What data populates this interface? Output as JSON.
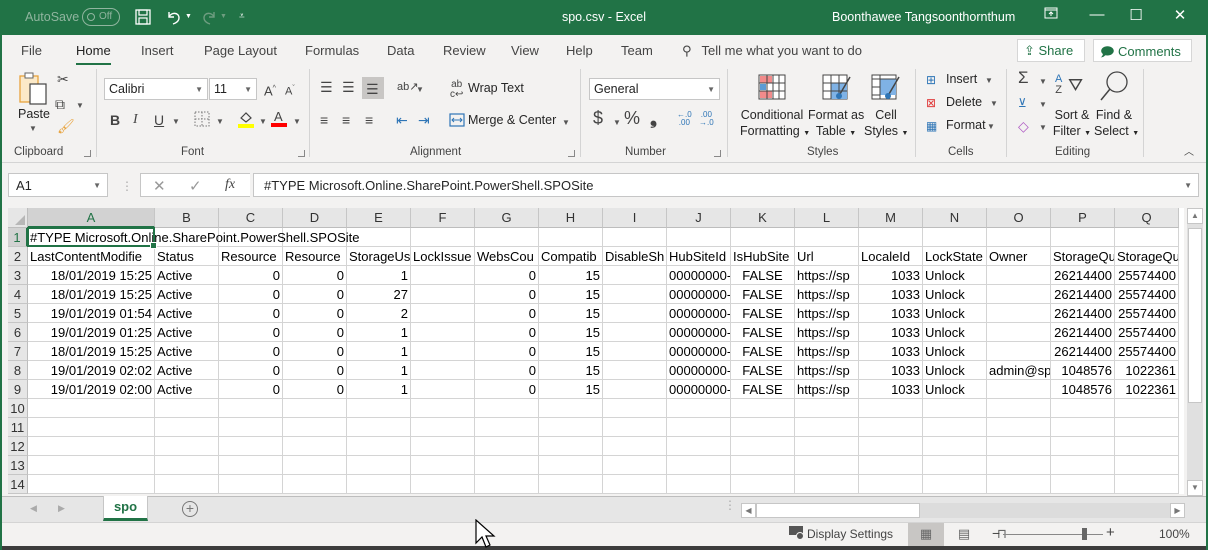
{
  "titlebar": {
    "autosave_label": "AutoSave",
    "autosave_state": "Off",
    "title": "spo.csv  -  Excel",
    "user": "Boonthawee Tangsoonthornthum",
    "icons": [
      "save-icon",
      "undo-icon",
      "redo-icon",
      "customize-qat-icon",
      "ribbon-display-icon",
      "minimize-icon",
      "maximize-icon",
      "close-icon"
    ]
  },
  "tabs": [
    {
      "label": "File"
    },
    {
      "label": "Home",
      "active": true
    },
    {
      "label": "Insert"
    },
    {
      "label": "Page Layout"
    },
    {
      "label": "Formulas"
    },
    {
      "label": "Data"
    },
    {
      "label": "Review"
    },
    {
      "label": "View"
    },
    {
      "label": "Help"
    },
    {
      "label": "Team"
    }
  ],
  "tell_me": "Tell me what you want to do",
  "share_label": "Share",
  "comments_label": "Comments",
  "ribbon": {
    "clipboard": {
      "label": "Clipboard",
      "paste": "Paste"
    },
    "font": {
      "label": "Font",
      "name": "Calibri",
      "size": "11",
      "bold": "B",
      "italic": "I",
      "underline": "U",
      "fill_color": "#ffff00",
      "font_color": "#ff0000"
    },
    "alignment": {
      "label": "Alignment",
      "wrap_text": "Wrap Text",
      "merge_center": "Merge & Center"
    },
    "number": {
      "label": "Number",
      "format": "General",
      "currency": "$",
      "percent": "%",
      "comma": "❟"
    },
    "styles": {
      "label": "Styles",
      "conditional_1": "Conditional",
      "conditional_2": "Formatting",
      "format_table_1": "Format as",
      "format_table_2": "Table",
      "cell_styles_1": "Cell",
      "cell_styles_2": "Styles"
    },
    "cells": {
      "label": "Cells",
      "insert": "Insert",
      "delete": "Delete",
      "format": "Format"
    },
    "editing": {
      "label": "Editing",
      "sort_1": "Sort &",
      "sort_2": "Filter",
      "find_1": "Find &",
      "find_2": "Select"
    }
  },
  "formula_bar": {
    "name_box": "A1",
    "cancel": "✕",
    "enter": "✓",
    "fx": "fx",
    "formula": "#TYPE Microsoft.Online.SharePoint.PowerShell.SPOSite"
  },
  "grid": {
    "columns": [
      "A",
      "B",
      "C",
      "D",
      "E",
      "F",
      "G",
      "H",
      "I",
      "J",
      "K",
      "L",
      "M",
      "N",
      "O",
      "P",
      "Q"
    ],
    "selected_column": "A",
    "selected_row": "1",
    "selected_cell": "A1",
    "row_numbers": [
      "1",
      "2",
      "3",
      "4",
      "5",
      "6",
      "7",
      "8",
      "9",
      "10",
      "11",
      "12",
      "13",
      "14"
    ],
    "rows": [
      [
        "#TYPE Microsoft.Online.SharePoint.PowerShell.SPOSite",
        "",
        "",
        "",
        "",
        "",
        "",
        "",
        "",
        "",
        "",
        "",
        "",
        "",
        "",
        "",
        ""
      ],
      [
        "LastContentModifie",
        "Status",
        "Resource\u0000",
        "Resource\u0000",
        "StorageUs",
        "LockIssue",
        "WebsCou",
        "Compatib",
        "DisableSh",
        "HubSiteId",
        "IsHubSite",
        "Url",
        "LocaleId",
        "LockState",
        "Owner",
        "StorageQu",
        "StorageQu"
      ],
      [
        "18/01/2019 15:25",
        "Active",
        "0",
        "0",
        "1",
        "",
        "0",
        "15",
        "",
        "00000000-",
        "FALSE",
        "https://sp",
        "1033",
        "Unlock",
        "",
        "26214400",
        "25574400"
      ],
      [
        "18/01/2019 15:25",
        "Active",
        "0",
        "0",
        "27",
        "",
        "0",
        "15",
        "",
        "00000000-",
        "FALSE",
        "https://sp",
        "1033",
        "Unlock",
        "",
        "26214400",
        "25574400"
      ],
      [
        "19/01/2019 01:54",
        "Active",
        "0",
        "0",
        "2",
        "",
        "0",
        "15",
        "",
        "00000000-",
        "FALSE",
        "https://sp",
        "1033",
        "Unlock",
        "",
        "26214400",
        "25574400"
      ],
      [
        "19/01/2019 01:25",
        "Active",
        "0",
        "0",
        "1",
        "",
        "0",
        "15",
        "",
        "00000000-",
        "FALSE",
        "https://sp",
        "1033",
        "Unlock",
        "",
        "26214400",
        "25574400"
      ],
      [
        "18/01/2019 15:25",
        "Active",
        "0",
        "0",
        "1",
        "",
        "0",
        "15",
        "",
        "00000000-",
        "FALSE",
        "https://sp",
        "1033",
        "Unlock",
        "",
        "26214400",
        "25574400"
      ],
      [
        "19/01/2019 02:02",
        "Active",
        "0",
        "0",
        "1",
        "",
        "0",
        "15",
        "",
        "00000000-",
        "FALSE",
        "https://sp",
        "1033",
        "Unlock",
        "admin@sp",
        "1048576",
        "1022361"
      ],
      [
        "19/01/2019 02:00",
        "Active",
        "0",
        "0",
        "1",
        "",
        "0",
        "15",
        "",
        "00000000-",
        "FALSE",
        "https://sp",
        "1033",
        "Unlock",
        "",
        "1048576",
        "1022361"
      ],
      [
        "",
        "",
        "",
        "",
        "",
        "",
        "",
        "",
        "",
        "",
        "",
        "",
        "",
        "",
        "",
        "",
        ""
      ],
      [
        "",
        "",
        "",
        "",
        "",
        "",
        "",
        "",
        "",
        "",
        "",
        "",
        "",
        "",
        "",
        "",
        ""
      ],
      [
        "",
        "",
        "",
        "",
        "",
        "",
        "",
        "",
        "",
        "",
        "",
        "",
        "",
        "",
        "",
        "",
        ""
      ],
      [
        "",
        "",
        "",
        "",
        "",
        "",
        "",
        "",
        "",
        "",
        "",
        "",
        "",
        "",
        "",
        "",
        ""
      ],
      [
        "",
        "",
        "",
        "",
        "",
        "",
        "",
        "",
        "",
        "",
        "",
        "",
        "",
        "",
        "",
        "",
        ""
      ]
    ]
  },
  "sheets": [
    {
      "name": "spo",
      "active": true
    }
  ],
  "status": {
    "display_settings": "Display Settings",
    "zoom_minus": "−",
    "zoom_plus": "+",
    "zoom_level": "100%",
    "zoom_fraction": 0.81
  },
  "colors": {
    "brand": "#217346"
  }
}
